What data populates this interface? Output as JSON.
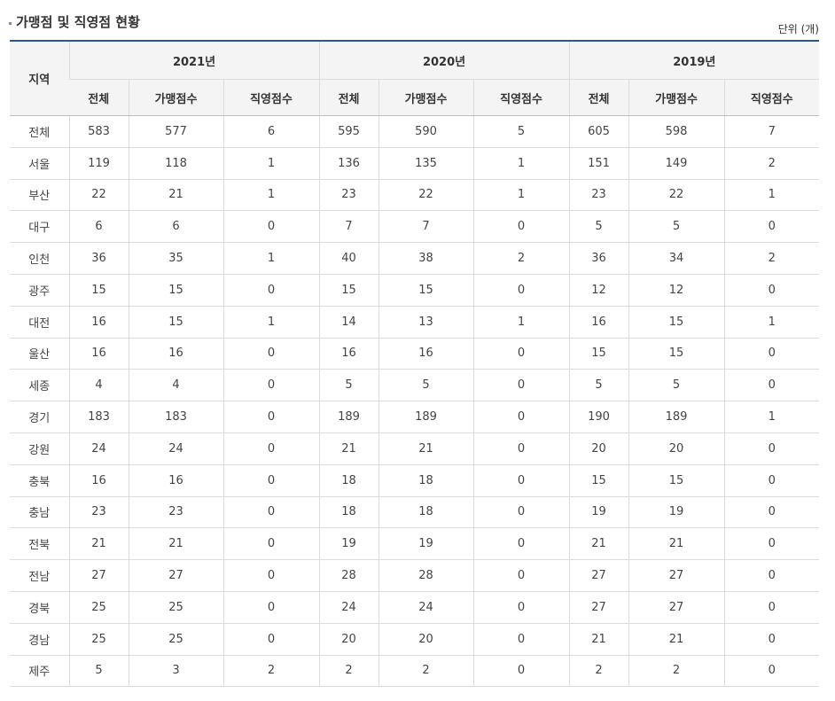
{
  "title": "가맹점 및 직영점 현황",
  "unit": "단위 (개)",
  "table": {
    "region_header": "지역",
    "years": [
      "2021년",
      "2020년",
      "2019년"
    ],
    "sub_headers": [
      "전체",
      "가맹점수",
      "직영점수",
      "전체",
      "가맹점수",
      "직영점수",
      "전체",
      "가맹점수",
      "직영점수"
    ],
    "rows": [
      [
        "전체",
        "583",
        "577",
        "6",
        "595",
        "590",
        "5",
        "605",
        "598",
        "7"
      ],
      [
        "서울",
        "119",
        "118",
        "1",
        "136",
        "135",
        "1",
        "151",
        "149",
        "2"
      ],
      [
        "부산",
        "22",
        "21",
        "1",
        "23",
        "22",
        "1",
        "23",
        "22",
        "1"
      ],
      [
        "대구",
        "6",
        "6",
        "0",
        "7",
        "7",
        "0",
        "5",
        "5",
        "0"
      ],
      [
        "인천",
        "36",
        "35",
        "1",
        "40",
        "38",
        "2",
        "36",
        "34",
        "2"
      ],
      [
        "광주",
        "15",
        "15",
        "0",
        "15",
        "15",
        "0",
        "12",
        "12",
        "0"
      ],
      [
        "대전",
        "16",
        "15",
        "1",
        "14",
        "13",
        "1",
        "16",
        "15",
        "1"
      ],
      [
        "울산",
        "16",
        "16",
        "0",
        "16",
        "16",
        "0",
        "15",
        "15",
        "0"
      ],
      [
        "세종",
        "4",
        "4",
        "0",
        "5",
        "5",
        "0",
        "5",
        "5",
        "0"
      ],
      [
        "경기",
        "183",
        "183",
        "0",
        "189",
        "189",
        "0",
        "190",
        "189",
        "1"
      ],
      [
        "강원",
        "24",
        "24",
        "0",
        "21",
        "21",
        "0",
        "20",
        "20",
        "0"
      ],
      [
        "충북",
        "16",
        "16",
        "0",
        "18",
        "18",
        "0",
        "15",
        "15",
        "0"
      ],
      [
        "충남",
        "23",
        "23",
        "0",
        "18",
        "18",
        "0",
        "19",
        "19",
        "0"
      ],
      [
        "전북",
        "21",
        "21",
        "0",
        "19",
        "19",
        "0",
        "21",
        "21",
        "0"
      ],
      [
        "전남",
        "27",
        "27",
        "0",
        "28",
        "28",
        "0",
        "27",
        "27",
        "0"
      ],
      [
        "경북",
        "25",
        "25",
        "0",
        "24",
        "24",
        "0",
        "27",
        "27",
        "0"
      ],
      [
        "경남",
        "25",
        "25",
        "0",
        "20",
        "20",
        "0",
        "21",
        "21",
        "0"
      ],
      [
        "제주",
        "5",
        "3",
        "2",
        "2",
        "2",
        "0",
        "2",
        "2",
        "0"
      ]
    ]
  }
}
